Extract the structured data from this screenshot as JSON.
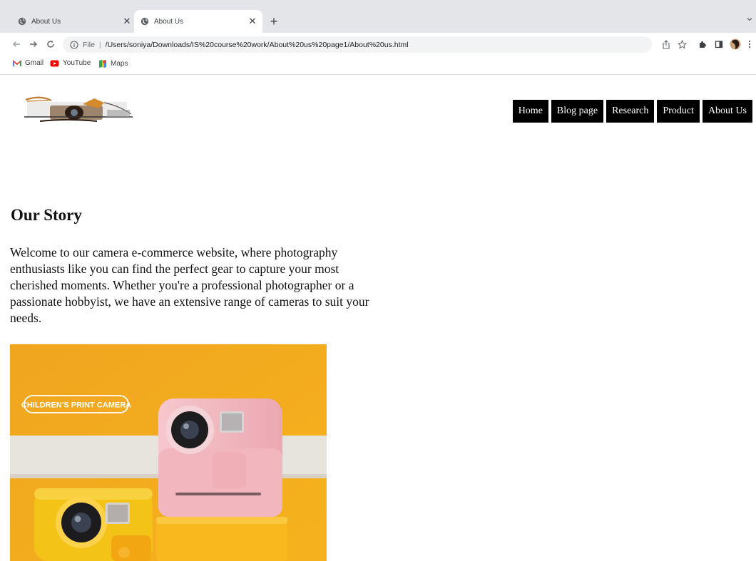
{
  "browser": {
    "tabs": [
      {
        "title": "About Us",
        "active": false
      },
      {
        "title": "About Us",
        "active": true
      }
    ],
    "address": {
      "scheme_label": "File",
      "url": "/Users/soniya/Downloads/IS%20course%20work/About%20us%20page1/About%20us.html"
    },
    "bookmarks": [
      {
        "label": "Gmail",
        "icon": "gmail-icon"
      },
      {
        "label": "YouTube",
        "icon": "youtube-icon"
      },
      {
        "label": "Maps",
        "icon": "maps-icon"
      }
    ]
  },
  "page": {
    "nav": [
      "Home",
      "Blog page",
      "Research",
      "Product",
      "About Us"
    ],
    "heading": "Our Story",
    "intro": "Welcome to our camera e-commerce website, where photography enthusiasts like you can find the perfect gear to capture your most cherished moments. Whether you're a professional photographer or a passionate hobbyist, we have an extensive range of cameras to suit your needs.",
    "hero_badge": "CHILDREN'S PRINT CAMERA",
    "colors": {
      "nav_bg": "#000000",
      "hero_bg": "#f0a41c",
      "pink_camera": "#f4bcc4",
      "yellow_camera": "#f6c21a"
    }
  }
}
